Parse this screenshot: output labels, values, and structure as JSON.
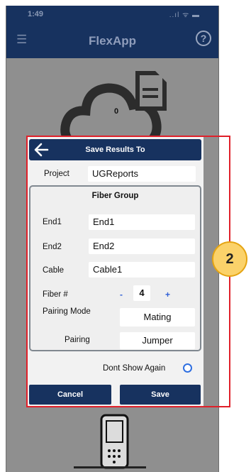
{
  "status_bar": {
    "time": "1:49",
    "signal": "..ıl ᯤ ▬"
  },
  "app_bar": {
    "title": "FlexApp",
    "help_glyph": "?"
  },
  "cloud": {
    "count": "0"
  },
  "dialog": {
    "title": "Save Results To",
    "project": {
      "label": "Project",
      "value": "UGReports"
    },
    "fiber_group": {
      "title": "Fiber Group",
      "end1": {
        "label": "End1",
        "value": "End1"
      },
      "end2": {
        "label": "End2",
        "value": "End2"
      },
      "cable": {
        "label": "Cable",
        "value": "Cable1"
      },
      "fiber": {
        "label": "Fiber #",
        "minus": "-",
        "value": "4",
        "plus": "+"
      },
      "pairing_mode": {
        "label": "Pairing Mode",
        "value": "Mating"
      },
      "pairing": {
        "label": "Pairing",
        "value": "Jumper"
      }
    },
    "dont_show_again": "Dont Show Again",
    "cancel_label": "Cancel",
    "save_label": "Save"
  },
  "annotation": {
    "badge": "2"
  },
  "colors": {
    "navy": "#17325f",
    "annotation_red": "#e0202a",
    "badge_fill": "#fbd26a"
  }
}
